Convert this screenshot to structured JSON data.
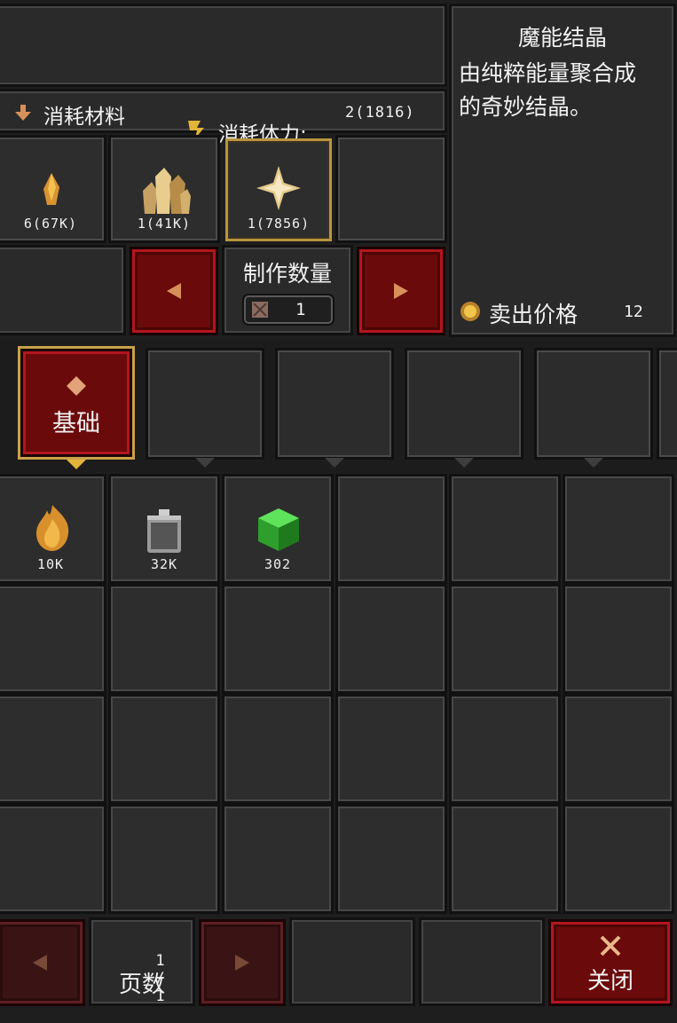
{
  "recipe": {
    "materials_label": "消耗材料",
    "stamina_label": "消耗体力:",
    "stamina_value": "2(1816)",
    "materials": [
      {
        "icon": "amber-shard-icon",
        "count": "6(67K)",
        "selected": false
      },
      {
        "icon": "gold-crystal-cluster-icon",
        "count": "1(41K)",
        "selected": false
      },
      {
        "icon": "four-point-star-icon",
        "count": "1(7856)",
        "selected": true
      },
      {
        "icon": "",
        "count": "",
        "selected": false
      }
    ]
  },
  "craft": {
    "quantity_label": "制作数量",
    "quantity_value": "1"
  },
  "item_info": {
    "name": "魔能结晶",
    "description_line1": "由纯粹能量聚合成",
    "description_line2": "的奇妙结晶。",
    "sell_label": "卖出价格",
    "sell_price": "12"
  },
  "tabs": [
    {
      "label": "基础",
      "active": true
    },
    {
      "label": "",
      "active": false
    },
    {
      "label": "",
      "active": false
    },
    {
      "label": "",
      "active": false
    },
    {
      "label": "",
      "active": false
    }
  ],
  "inventory": [
    {
      "icon": "amber-flame-icon",
      "count": "10K"
    },
    {
      "icon": "gray-canister-icon",
      "count": "32K"
    },
    {
      "icon": "green-cube-icon",
      "count": "302"
    }
  ],
  "footer": {
    "page_current": "1",
    "page_separator": "/",
    "page_total": "1",
    "page_label": "页数",
    "close_label": "关闭"
  },
  "colors": {
    "accent_gold": "#c8a24a",
    "button_red": "#b3151f"
  }
}
